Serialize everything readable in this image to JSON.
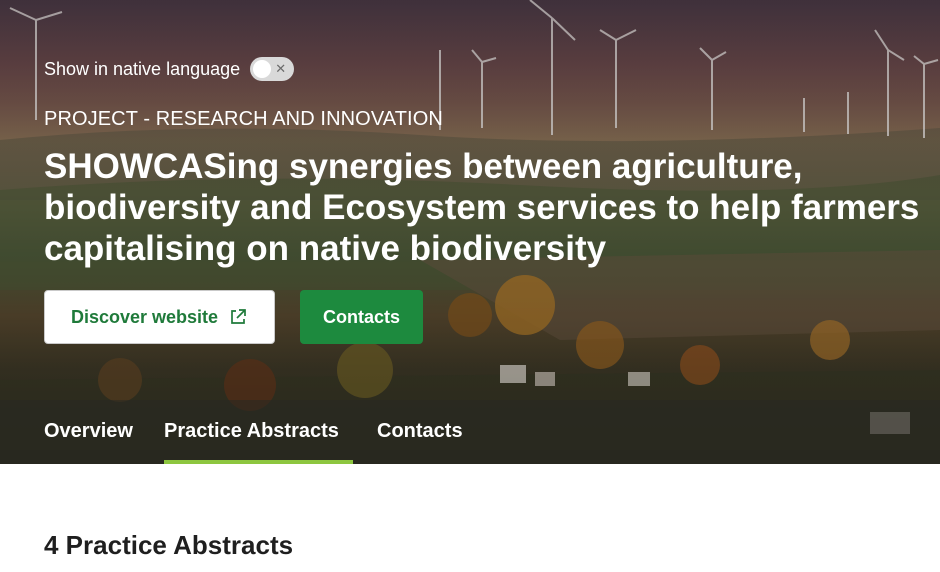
{
  "language_toggle": {
    "label": "Show in native language",
    "enabled": false,
    "off_glyph": "✕"
  },
  "project": {
    "eyebrow": "PROJECT - RESEARCH AND INNOVATION",
    "title": "SHOWCASing synergies between agriculture, biodiversity and Ecosystem services to help farmers capitalising on native biodiversity"
  },
  "actions": {
    "discover_label": "Discover website",
    "discover_icon": "external-link-icon",
    "contacts_label": "Contacts"
  },
  "tabs": [
    {
      "label": "Overview",
      "active": false
    },
    {
      "label": "Practice Abstracts",
      "active": true
    },
    {
      "label": "Contacts",
      "active": false
    }
  ],
  "section": {
    "heading": "4 Practice Abstracts"
  },
  "colors": {
    "primary_green": "#1d8a3e",
    "active_tab_underline": "#8dc63f",
    "link_green": "#1f7a3a"
  }
}
